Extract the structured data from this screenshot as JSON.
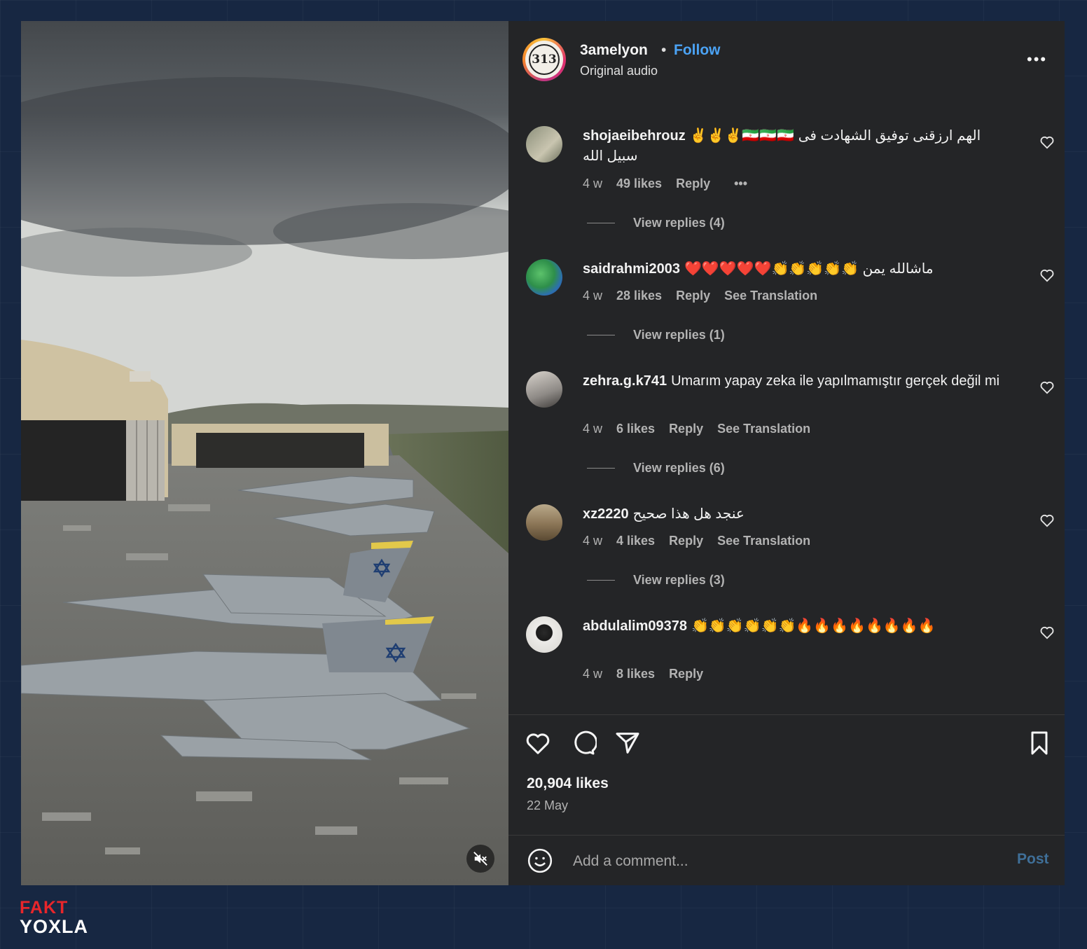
{
  "post": {
    "username": "3amelyon",
    "separator": "•",
    "follow_label": "Follow",
    "audio": "Original audio",
    "avatar_text": "313",
    "more_label": "•••"
  },
  "comments": [
    {
      "user": "shojaeibehrouz",
      "text": "✌️✌️✌️🇮🇷🇮🇷🇮🇷 الهم ارزقنی توفیق الشهادت فی سبیل الله",
      "time": "4 w",
      "likes": "49 likes",
      "reply": "Reply",
      "extra": "•••",
      "view_replies": "View replies (4)"
    },
    {
      "user": "saidrahmi2003",
      "text": "❤️❤️❤️❤️❤️👏👏👏👏👏 ماشالله يمن",
      "time": "4 w",
      "likes": "28 likes",
      "reply": "Reply",
      "extra": "See Translation",
      "view_replies": "View replies (1)"
    },
    {
      "user": "zehra.g.k741",
      "text": "Umarım yapay zeka ile yapılmamıştır gerçek değil mi",
      "time": "4 w",
      "likes": "6 likes",
      "reply": "Reply",
      "extra": "See Translation",
      "view_replies": "View replies (6)"
    },
    {
      "user": "xz2220",
      "text": "عنجد هل هذا صحيح",
      "time": "4 w",
      "likes": "4 likes",
      "reply": "Reply",
      "extra": "See Translation",
      "view_replies": "View replies (3)"
    },
    {
      "user": "abdulalim09378",
      "text": "👏👏👏👏👏👏🔥🔥🔥🔥🔥🔥🔥🔥",
      "time": "4 w",
      "likes": "8 likes",
      "reply": "Reply"
    }
  ],
  "footer": {
    "likes": "20,904 likes",
    "date": "22 May",
    "comment_placeholder": "Add a comment...",
    "post_label": "Post"
  },
  "icons": {
    "heart": "heart-icon",
    "comment": "comment-bubble-icon",
    "share": "paper-plane-icon",
    "save": "bookmark-icon",
    "emoji": "smiley-icon",
    "mute": "speaker-muted-icon"
  },
  "brand": {
    "logo_line1": "FAKT",
    "logo_line2": "YOXLA",
    "logo_red": "#e8262b"
  },
  "colors": {
    "follow_blue": "#4ba3f5",
    "panel": "#242527",
    "page_bg": "#172742"
  }
}
